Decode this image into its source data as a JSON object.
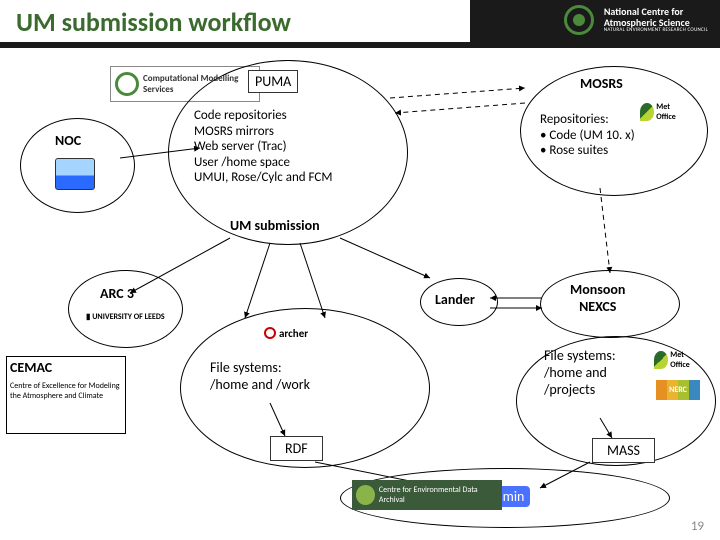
{
  "header": {
    "title": "UM submission workflow",
    "ncas_name": "National Centre for",
    "ncas_sub": "Atmospheric Science",
    "ncas_small": "NATURAL ENVIRONMENT RESEARCH COUNCIL"
  },
  "nodes": {
    "cms_logo": "Computational Modelling Services",
    "noc": "NOC",
    "puma": {
      "title": "PUMA",
      "lines": "Code repositories\nMOSRS mirrors\nWeb server (Trac)\nUser /home space\nUMUI, Rose/Cylc and FCM",
      "sub": "UM submission"
    },
    "mosrs": {
      "title": "MOSRS",
      "repos_label": "Repositories:",
      "repo1": "•  Code (UM 10. x)",
      "repo2": "•  Rose suites"
    },
    "arc3": "ARC 3",
    "leeds": "▮ UNIVERSITY OF LEEDS",
    "lander": "Lander",
    "monsoon": "Monsoon\nNEXCS",
    "cemac": "CEMAC",
    "cemac_sub": "Centre of Excellence for Modeling the Atmosphere and Climate",
    "archer": {
      "fs": "File systems:\n/home and /work",
      "logo": "archer"
    },
    "metfs": "File systems:\n/home and\n/projects",
    "rdf": "RDF",
    "mass": "MASS",
    "jasmin": "Jasmin",
    "ceda": "Centre for Environmental Data Archival",
    "nerc": "NERC",
    "metoffice": "Met Office"
  },
  "page": "19"
}
